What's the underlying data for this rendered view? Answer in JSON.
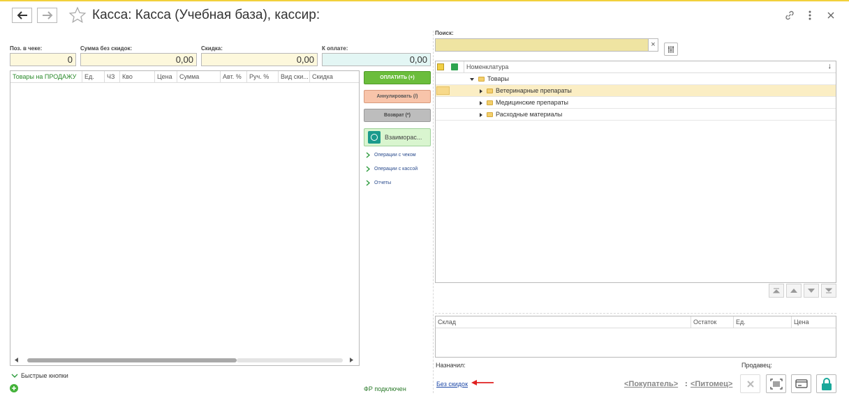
{
  "window": {
    "title": "Касса: Касса (Учебная база), кассир:"
  },
  "totals": {
    "positions_label": "Поз. в чеке:",
    "positions_value": "0",
    "sum_label": "Сумма без скидок:",
    "sum_value": "0,00",
    "discount_label": "Скидка:",
    "discount_value": "0,00",
    "topay_label": "К оплате:",
    "topay_value": "0,00"
  },
  "cart_table": {
    "columns": [
      "Товары на ПРОДАЖУ",
      "Ед.",
      "ЧЗ",
      "Кво",
      "Цена",
      "Сумма",
      "Авт. %",
      "Руч. %",
      "Вид ски...",
      "Скидка"
    ]
  },
  "actions": {
    "pay": "ОПЛАТИТЬ (+)",
    "cancel": "Аннулировать (/)",
    "return": "Возврат (*)",
    "settlements": "Взаиморас..."
  },
  "menus": {
    "receipt_ops": "Операции с чеком",
    "cash_ops": "Операции с кассой",
    "reports": "Отчеты"
  },
  "footer_left": {
    "quick_buttons": "Быстрые кнопки",
    "fr_status": "ФР подключен"
  },
  "search": {
    "label": "Поиск:",
    "value": "",
    "clear": "×"
  },
  "catalog": {
    "column": "Номенклатура",
    "sort_arrow": "↓",
    "rows": [
      {
        "label": "Товары",
        "level": 0,
        "expanded": true
      },
      {
        "label": "Ветеринарные препараты",
        "level": 1,
        "expanded": false
      },
      {
        "label": "Медицинские препараты",
        "level": 1,
        "expanded": false
      },
      {
        "label": "Расходные материалы",
        "level": 1,
        "expanded": false
      }
    ]
  },
  "stock_table": {
    "columns": [
      "Склад",
      "Остаток",
      "Ед.",
      "Цена"
    ]
  },
  "footer_right": {
    "assigned_label": "Назначил:",
    "seller_label": "Продавец:",
    "no_discount": "Без скидок",
    "buyer": "<Покупатель>",
    "separator": ":",
    "pet": "<Питомец>"
  },
  "colors": {
    "accent_yellow": "#f2d03b",
    "pay_green": "#6bbd3c",
    "lock_teal": "#1aa89a",
    "arrow_red": "#e02020"
  }
}
